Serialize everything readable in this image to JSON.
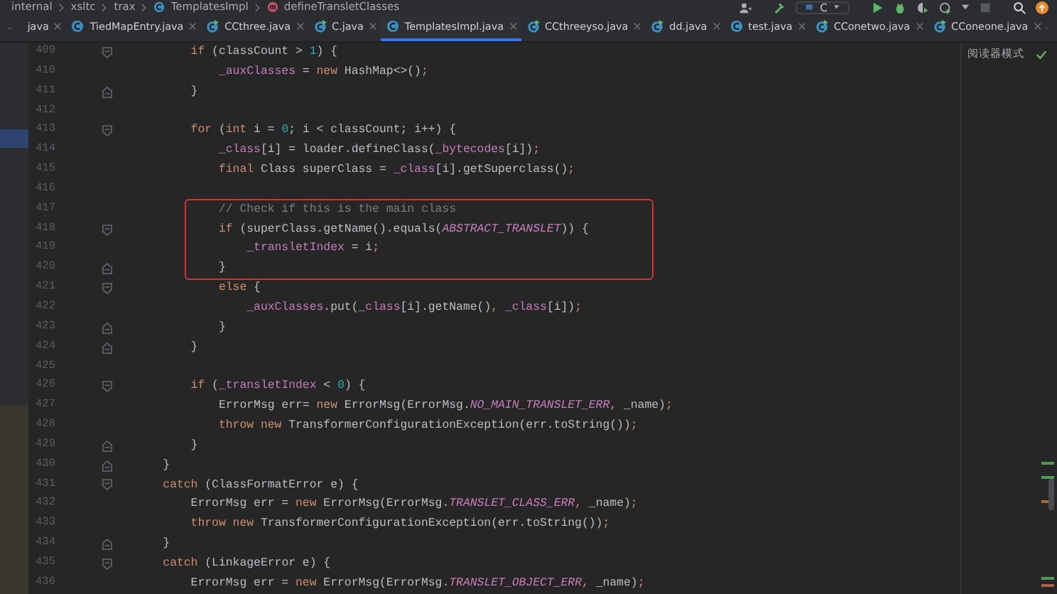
{
  "breadcrumbs": [
    {
      "label": "internal",
      "kind": "package"
    },
    {
      "label": "xsltc",
      "kind": "package"
    },
    {
      "label": "trax",
      "kind": "package"
    },
    {
      "label": "TemplatesImpl",
      "kind": "class"
    },
    {
      "label": "defineTransletClasses",
      "kind": "method"
    }
  ],
  "toolbar": {
    "run_config": "C"
  },
  "tabs": [
    {
      "label": "java",
      "selected": false,
      "kind": "cut"
    },
    {
      "label": "TiedMapEntry.java",
      "selected": false,
      "kind": "class"
    },
    {
      "label": "CCthree.java",
      "selected": false,
      "kind": "runnable"
    },
    {
      "label": "C.java",
      "selected": false,
      "kind": "runnable"
    },
    {
      "label": "TemplatesImpl.java",
      "selected": true,
      "kind": "class"
    },
    {
      "label": "CCthreeyso.java",
      "selected": false,
      "kind": "runnable"
    },
    {
      "label": "dd.java",
      "selected": false,
      "kind": "runnable"
    },
    {
      "label": "test.java",
      "selected": false,
      "kind": "class"
    },
    {
      "label": "CConetwo.java",
      "selected": false,
      "kind": "runnable"
    },
    {
      "label": "CConeone.java",
      "selected": false,
      "kind": "runnable"
    }
  ],
  "reader_mode": "阅读器模式",
  "lines": [
    {
      "number": "409",
      "kind": "fold-start",
      "boxed": false,
      "tokens": [
        {
          "text": "        if",
          "kind": "keyword"
        },
        {
          "text": " (classCount > ",
          "kind": "plain"
        },
        {
          "text": "1",
          "kind": "number"
        },
        {
          "text": ") {",
          "kind": "plain"
        }
      ]
    },
    {
      "number": "410",
      "kind": "plain",
      "boxed": false,
      "tokens": [
        {
          "text": "            _auxClasses",
          "kind": "field"
        },
        {
          "text": " = ",
          "kind": "plain"
        },
        {
          "text": "new",
          "kind": "keyword"
        },
        {
          "text": " HashMap<>()",
          "kind": "plain"
        },
        {
          "text": ";",
          "kind": "keyword"
        }
      ]
    },
    {
      "number": "411",
      "kind": "fold-end",
      "boxed": false,
      "tokens": [
        {
          "text": "        }",
          "kind": "plain"
        }
      ]
    },
    {
      "number": "412",
      "kind": "plain",
      "boxed": false
    },
    {
      "number": "413",
      "kind": "fold-start",
      "boxed": false,
      "tokens": [
        {
          "text": "        for",
          "kind": "keyword"
        },
        {
          "text": " (",
          "kind": "plain"
        },
        {
          "text": "int",
          "kind": "keyword"
        },
        {
          "text": " i = ",
          "kind": "plain"
        },
        {
          "text": "0",
          "kind": "number"
        },
        {
          "text": "; i < classCount; i++) {",
          "kind": "plain"
        }
      ]
    },
    {
      "number": "414",
      "kind": "plain",
      "boxed": false,
      "tokens": [
        {
          "text": "            _class",
          "kind": "field"
        },
        {
          "text": "[i] = loader.defineClass(",
          "kind": "plain"
        },
        {
          "text": "_bytecodes",
          "kind": "field"
        },
        {
          "text": "[i])",
          "kind": "plain"
        },
        {
          "text": ";",
          "kind": "keyword"
        }
      ]
    },
    {
      "number": "415",
      "kind": "plain",
      "boxed": false,
      "tokens": [
        {
          "text": "            final",
          "kind": "keyword"
        },
        {
          "text": " Class superClass = ",
          "kind": "plain"
        },
        {
          "text": "_class",
          "kind": "field"
        },
        {
          "text": "[i].getSuperclass()",
          "kind": "plain"
        },
        {
          "text": ";",
          "kind": "keyword"
        }
      ]
    },
    {
      "number": "416",
      "kind": "plain",
      "boxed": false
    },
    {
      "number": "417",
      "kind": "plain",
      "boxed": true,
      "tokens": [
        {
          "text": "            // Check if this is the main class",
          "kind": "comment"
        }
      ]
    },
    {
      "number": "418",
      "kind": "fold-start",
      "boxed": true,
      "tokens": [
        {
          "text": "            if",
          "kind": "keyword"
        },
        {
          "text": " (superClass.getName().equals(",
          "kind": "plain"
        },
        {
          "text": "ABSTRACT_TRANSLET",
          "kind": "constant"
        },
        {
          "text": ")) {",
          "kind": "plain"
        }
      ]
    },
    {
      "number": "419",
      "kind": "plain",
      "boxed": true,
      "tokens": [
        {
          "text": "                _transletIndex",
          "kind": "field"
        },
        {
          "text": " = i",
          "kind": "plain"
        },
        {
          "text": ";",
          "kind": "keyword"
        }
      ]
    },
    {
      "number": "420",
      "kind": "fold-end",
      "boxed": true,
      "tokens": [
        {
          "text": "            }",
          "kind": "plain"
        }
      ]
    },
    {
      "number": "421",
      "kind": "fold-start",
      "boxed": false,
      "tokens": [
        {
          "text": "            else",
          "kind": "keyword"
        },
        {
          "text": " {",
          "kind": "plain"
        }
      ]
    },
    {
      "number": "422",
      "kind": "plain",
      "boxed": false,
      "tokens": [
        {
          "text": "                _auxClasses",
          "kind": "field"
        },
        {
          "text": ".put(",
          "kind": "plain"
        },
        {
          "text": "_class",
          "kind": "field"
        },
        {
          "text": "[i].getName()",
          "kind": "plain"
        },
        {
          "text": ",",
          "kind": "keyword"
        },
        {
          "text": " _class",
          "kind": "field"
        },
        {
          "text": "[i])",
          "kind": "plain"
        },
        {
          "text": ";",
          "kind": "keyword"
        }
      ]
    },
    {
      "number": "423",
      "kind": "fold-end",
      "boxed": false,
      "tokens": [
        {
          "text": "            }",
          "kind": "plain"
        }
      ]
    },
    {
      "number": "424",
      "kind": "fold-end",
      "boxed": false,
      "tokens": [
        {
          "text": "        }",
          "kind": "plain"
        }
      ]
    },
    {
      "number": "425",
      "kind": "plain",
      "boxed": false
    },
    {
      "number": "426",
      "kind": "fold-start",
      "boxed": false,
      "tokens": [
        {
          "text": "        if",
          "kind": "keyword"
        },
        {
          "text": " (",
          "kind": "plain"
        },
        {
          "text": "_transletIndex",
          "kind": "field"
        },
        {
          "text": " < ",
          "kind": "plain"
        },
        {
          "text": "0",
          "kind": "number"
        },
        {
          "text": ") {",
          "kind": "plain"
        }
      ]
    },
    {
      "number": "427",
      "kind": "plain",
      "boxed": false,
      "tokens": [
        {
          "text": "            ErrorMsg err= ",
          "kind": "plain"
        },
        {
          "text": "new",
          "kind": "keyword"
        },
        {
          "text": " ErrorMsg(ErrorMsg.",
          "kind": "plain"
        },
        {
          "text": "NO_MAIN_TRANSLET_ERR",
          "kind": "constant"
        },
        {
          "text": ",",
          "kind": "keyword"
        },
        {
          "text": " _name)",
          "kind": "plain"
        },
        {
          "text": ";",
          "kind": "keyword"
        }
      ]
    },
    {
      "number": "428",
      "kind": "plain",
      "boxed": false,
      "tokens": [
        {
          "text": "            throw new",
          "kind": "keyword"
        },
        {
          "text": " TransformerConfigurationException(err.toString())",
          "kind": "plain"
        },
        {
          "text": ";",
          "kind": "keyword"
        }
      ]
    },
    {
      "number": "429",
      "kind": "fold-end",
      "boxed": false,
      "tokens": [
        {
          "text": "        }",
          "kind": "plain"
        }
      ]
    },
    {
      "number": "430",
      "kind": "fold-end",
      "boxed": false,
      "tokens": [
        {
          "text": "    }",
          "kind": "plain"
        }
      ]
    },
    {
      "number": "431",
      "kind": "fold-start",
      "boxed": false,
      "tokens": [
        {
          "text": "    catch",
          "kind": "keyword"
        },
        {
          "text": " (ClassFormatError e) {",
          "kind": "plain"
        }
      ]
    },
    {
      "number": "432",
      "kind": "plain",
      "boxed": false,
      "tokens": [
        {
          "text": "        ErrorMsg err = ",
          "kind": "plain"
        },
        {
          "text": "new",
          "kind": "keyword"
        },
        {
          "text": " ErrorMsg(ErrorMsg.",
          "kind": "plain"
        },
        {
          "text": "TRANSLET_CLASS_ERR",
          "kind": "constant"
        },
        {
          "text": ",",
          "kind": "keyword"
        },
        {
          "text": " _name)",
          "kind": "plain"
        },
        {
          "text": ";",
          "kind": "keyword"
        }
      ]
    },
    {
      "number": "433",
      "kind": "plain",
      "boxed": false,
      "tokens": [
        {
          "text": "        throw new",
          "kind": "keyword"
        },
        {
          "text": " TransformerConfigurationException(err.toString())",
          "kind": "plain"
        },
        {
          "text": ";",
          "kind": "keyword"
        }
      ]
    },
    {
      "number": "434",
      "kind": "fold-end",
      "boxed": false,
      "tokens": [
        {
          "text": "    }",
          "kind": "plain"
        }
      ]
    },
    {
      "number": "435",
      "kind": "fold-start",
      "boxed": false,
      "tokens": [
        {
          "text": "    catch",
          "kind": "keyword"
        },
        {
          "text": " (LinkageError e) {",
          "kind": "plain"
        }
      ]
    },
    {
      "number": "436",
      "kind": "plain",
      "boxed": false,
      "tokens": [
        {
          "text": "        ErrorMsg err = ",
          "kind": "plain"
        },
        {
          "text": "new",
          "kind": "keyword"
        },
        {
          "text": " ErrorMsg(ErrorMsg.",
          "kind": "plain"
        },
        {
          "text": "TRANSLET_OBJECT_ERR",
          "kind": "constant"
        },
        {
          "text": ",",
          "kind": "keyword"
        },
        {
          "text": " _name)",
          "kind": "plain"
        },
        {
          "text": ";",
          "kind": "keyword"
        }
      ]
    }
  ]
}
